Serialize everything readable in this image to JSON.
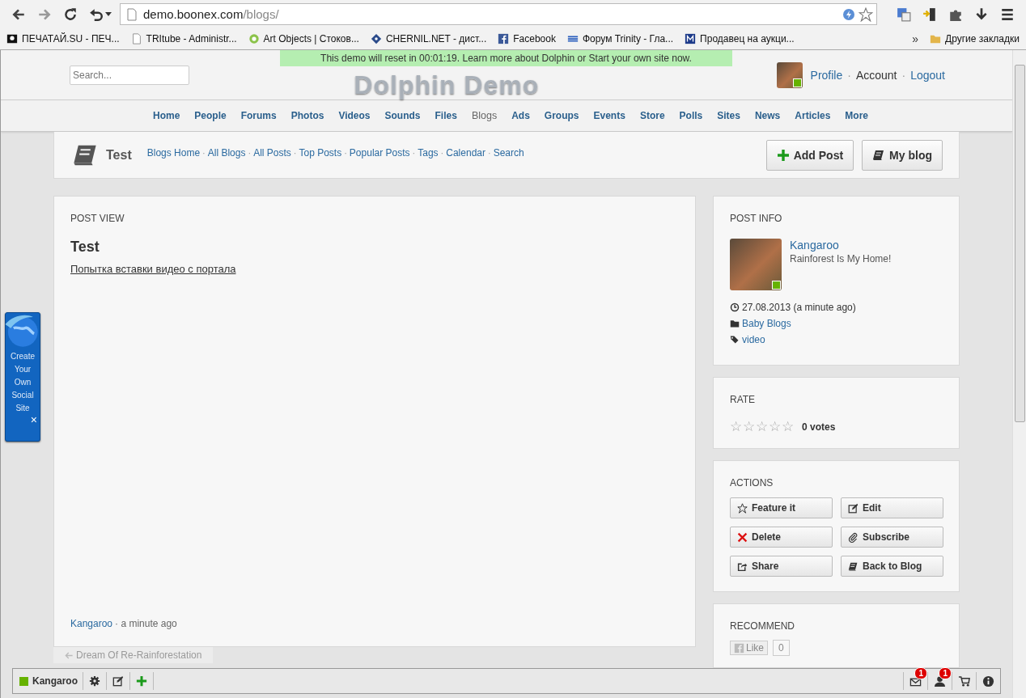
{
  "browser": {
    "url_host": "demo.boonex.com",
    "url_path": "/blogs/",
    "bookmarks": [
      {
        "label": "ПЕЧАТАЙ.SU - ПЕЧ...",
        "kind": "pirate"
      },
      {
        "label": "TRItube - Administr...",
        "kind": "page"
      },
      {
        "label": "Art Objects | Стоков...",
        "kind": "ring"
      },
      {
        "label": "CHERNIL.NET - дист...",
        "kind": "diamond"
      },
      {
        "label": "Facebook",
        "kind": "facebook"
      },
      {
        "label": "Форум Trinity - Гла...",
        "kind": "stripes"
      },
      {
        "label": "Продавец на аукци...",
        "kind": "square"
      }
    ],
    "overflow": "»",
    "other_bookmarks": "Другие закладки"
  },
  "demo_notice": "This demo will reset in 00:01:19. Learn more about Dolphin or Start your own site now.",
  "header": {
    "search_placeholder": "Search...",
    "logo": "Dolphin Demo",
    "online": true,
    "user_links": [
      "Profile",
      "Account",
      "Logout"
    ],
    "separator": "·"
  },
  "nav": [
    {
      "label": "Home",
      "selected": false
    },
    {
      "label": "People",
      "selected": false
    },
    {
      "label": "Forums",
      "selected": false
    },
    {
      "label": "Photos",
      "selected": false
    },
    {
      "label": "Videos",
      "selected": false
    },
    {
      "label": "Sounds",
      "selected": false
    },
    {
      "label": "Files",
      "selected": false
    },
    {
      "label": "Blogs",
      "selected": true
    },
    {
      "label": "Ads",
      "selected": false
    },
    {
      "label": "Groups",
      "selected": false
    },
    {
      "label": "Events",
      "selected": false
    },
    {
      "label": "Store",
      "selected": false
    },
    {
      "label": "Polls",
      "selected": false
    },
    {
      "label": "Sites",
      "selected": false
    },
    {
      "label": "News",
      "selected": false
    },
    {
      "label": "Articles",
      "selected": false
    },
    {
      "label": "More",
      "selected": false
    }
  ],
  "submenu": {
    "title": "Test",
    "links": [
      "Blogs Home",
      "All Blogs",
      "All Posts",
      "Top Posts",
      "Popular Posts",
      "Tags",
      "Calendar",
      "Search"
    ],
    "separator": "·",
    "buttons": [
      {
        "label": "Add Post",
        "kind": "plus"
      },
      {
        "label": "My blog",
        "kind": "book"
      }
    ]
  },
  "post": {
    "heading": "POST VIEW",
    "title": "Test",
    "body": "Попытка вставки видео с портала",
    "author": "Kangaroo",
    "time": "· a minute ago",
    "prev_link": "Dream Of Re-Rainforestation"
  },
  "post_info": {
    "heading": "POST INFO",
    "author": "Kangaroo",
    "status": "Rainforest Is My Home!",
    "online": true,
    "date": "27.08.2013 (a minute ago)",
    "category": "Baby Blogs",
    "tag": "video"
  },
  "rate": {
    "heading": "RATE",
    "stars": 0,
    "votes": "0 votes"
  },
  "actions": {
    "heading": "ACTIONS",
    "buttons": [
      {
        "label": "Feature it",
        "kind": "star"
      },
      {
        "label": "Edit",
        "kind": "edit"
      },
      {
        "label": "Delete",
        "kind": "cross"
      },
      {
        "label": "Subscribe",
        "kind": "clip"
      },
      {
        "label": "Share",
        "kind": "share"
      },
      {
        "label": "Back to Blog",
        "kind": "book"
      }
    ]
  },
  "recommend": {
    "heading": "RECOMMEND",
    "like": "Like",
    "count": "0"
  },
  "promo": {
    "text": "Create Your Own Social Site",
    "close": "×"
  },
  "toolbar": {
    "user": "Kangaroo",
    "online": true,
    "items": [
      {
        "kind": "mail",
        "count": "1"
      },
      {
        "kind": "person",
        "count": "1"
      },
      {
        "kind": "cart"
      },
      {
        "kind": "info"
      }
    ]
  }
}
